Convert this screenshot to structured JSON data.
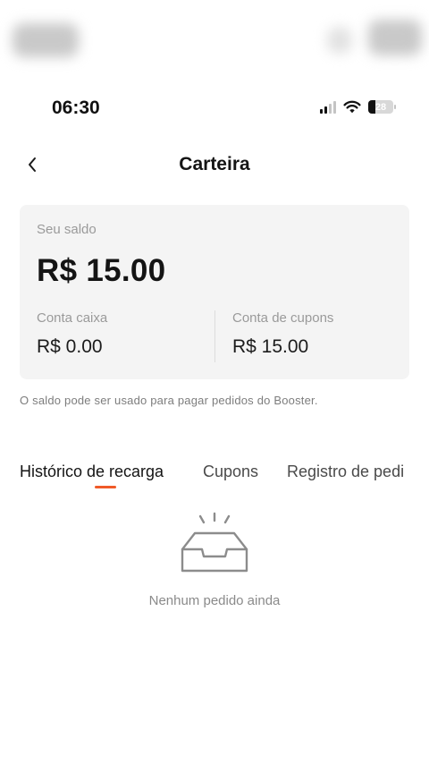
{
  "status_bar": {
    "time": "06:30",
    "battery_level": "28"
  },
  "header": {
    "title": "Carteira",
    "back_icon": "chevron-left-icon"
  },
  "balance": {
    "label": "Seu saldo",
    "amount": "R$ 15.00",
    "cash_account_label": "Conta caixa",
    "cash_account_value": "R$ 0.00",
    "coupon_account_label": "Conta de cupons",
    "coupon_account_value": "R$ 15.00"
  },
  "note": "O saldo pode ser usado para pagar pedidos do Booster.",
  "tabs": [
    {
      "label": "Histórico de recarga",
      "active": true
    },
    {
      "label": "Cupons",
      "active": false
    },
    {
      "label": "Registro de pedi",
      "active": false
    }
  ],
  "empty_state": {
    "icon": "empty-inbox-icon",
    "text": "Nenhum pedido ainda"
  },
  "colors": {
    "accent": "#f05a28",
    "card_bg": "#f4f4f4"
  }
}
